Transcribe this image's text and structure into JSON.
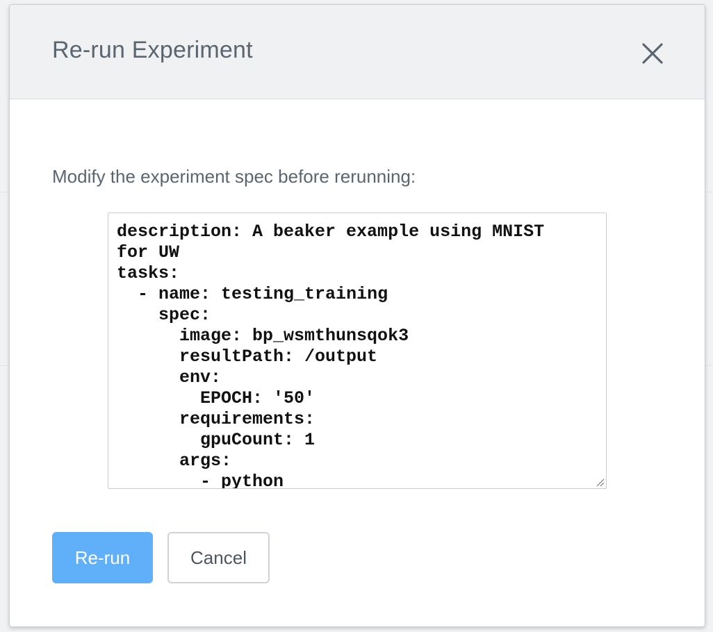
{
  "modal": {
    "title": "Re-run Experiment",
    "close_icon": "close-icon",
    "prompt": "Modify the experiment spec before rerunning:",
    "spec_text": "description: A beaker example using MNIST\nfor UW\ntasks:\n  - name: testing_training\n    spec:\n      image: bp_wsmthunsqok3\n      resultPath: /output\n      env:\n        EPOCH: '50'\n      requirements:\n        gpuCount: 1\n      args:\n        - python",
    "rerun_label": "Re-run",
    "cancel_label": "Cancel"
  },
  "colors": {
    "primary_button": "#5fb0f8",
    "header_bg": "#eff1f3",
    "text": "#5b6570"
  }
}
